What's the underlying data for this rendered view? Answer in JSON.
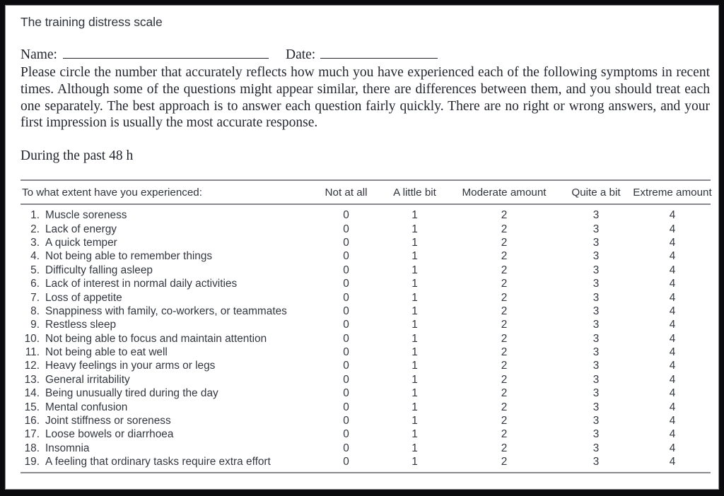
{
  "document": {
    "title": "The training distress scale",
    "name_label": "Name:",
    "date_label": "Date:",
    "instructions": "Please circle the number that accurately reflects how much you have experienced each of the following symptoms in recent times. Although some of the questions might appear similar, there are differences between them, and you should treat each one separately. The best approach is to answer each question fairly quickly. There are no right or wrong answers, and your first impression is usually the most accurate response.",
    "timeframe": "During the past 48 h"
  },
  "table": {
    "prompt_header": "To what extent have you experienced:",
    "scale_headers": [
      "Not at all",
      "A little bit",
      "Moderate amount",
      "Quite a bit",
      "Extreme amount"
    ],
    "scale_values": [
      "0",
      "1",
      "2",
      "3",
      "4"
    ],
    "items": [
      {
        "number": "1.",
        "text": "Muscle soreness"
      },
      {
        "number": "2.",
        "text": "Lack of energy"
      },
      {
        "number": "3.",
        "text": "A quick temper"
      },
      {
        "number": "4.",
        "text": "Not being able to remember things"
      },
      {
        "number": "5.",
        "text": "Difficulty falling asleep"
      },
      {
        "number": "6.",
        "text": "Lack of interest in normal daily activities"
      },
      {
        "number": "7.",
        "text": "Loss of appetite"
      },
      {
        "number": "8.",
        "text": "Snappiness with family, co-workers, or teammates"
      },
      {
        "number": "9.",
        "text": "Restless sleep"
      },
      {
        "number": "10.",
        "text": "Not being able to focus and maintain attention"
      },
      {
        "number": "11.",
        "text": "Not being able to eat well"
      },
      {
        "number": "12.",
        "text": "Heavy feelings in your arms or legs"
      },
      {
        "number": "13.",
        "text": "General irritability"
      },
      {
        "number": "14.",
        "text": "Being unusually tired during the day"
      },
      {
        "number": "15.",
        "text": "Mental confusion"
      },
      {
        "number": "16.",
        "text": "Joint stiffness or soreness"
      },
      {
        "number": "17.",
        "text": "Loose bowels or diarrhoea"
      },
      {
        "number": "18.",
        "text": "Insomnia"
      },
      {
        "number": "19.",
        "text": "A feeling that ordinary tasks require extra effort"
      }
    ]
  },
  "style": {
    "frame_color": "#0b0b0e",
    "page_background": "#ffffff",
    "text_color": "#23262e",
    "rule_color": "#8a8a8e"
  }
}
